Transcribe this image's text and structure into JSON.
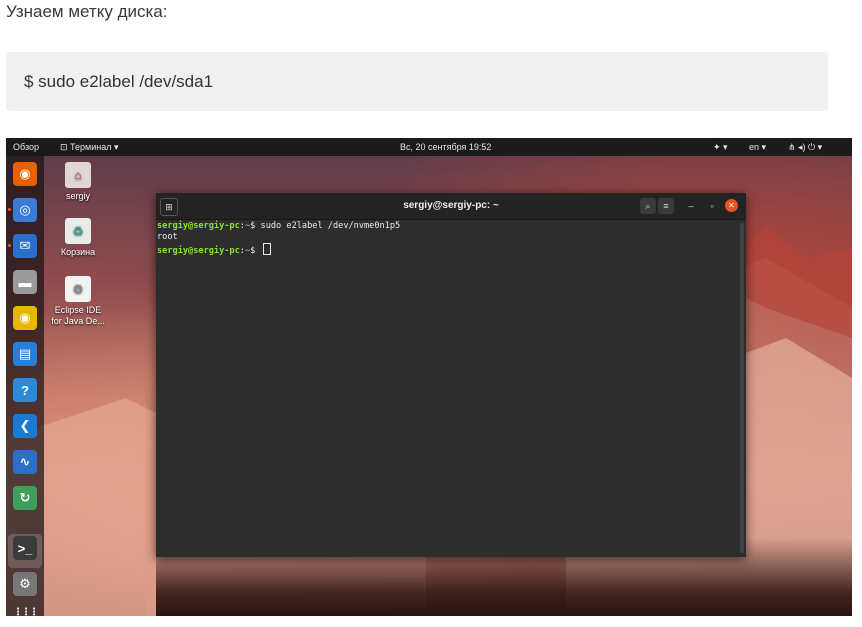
{
  "article": {
    "heading": "Узнаем метку диска:",
    "code": "$  sudo e2label /dev/sda1"
  },
  "topbar": {
    "activities": "Обзор",
    "app_menu": "Терминал",
    "app_menu_arrow": "▾",
    "clock": "Вс, 20 сентября  19:52",
    "accessibility": "✦ ▾",
    "lang": "en ▾",
    "system": "⋔ ◂) ⏻ ▾"
  },
  "desktop": {
    "icons": [
      {
        "label": "sergiy",
        "glyph": "⌂"
      },
      {
        "label": "Корзина",
        "glyph": "♻"
      },
      {
        "label": "Eclipse IDE\nfor Java De...",
        "glyph": "⚙"
      }
    ]
  },
  "dock": {
    "apps": [
      {
        "name": "firefox-icon",
        "glyph": "◉",
        "color": "#e66000"
      },
      {
        "name": "chromium-icon",
        "glyph": "◎",
        "color": "#3b7bd5"
      },
      {
        "name": "thunderbird-icon",
        "glyph": "✉",
        "color": "#2a6fc9"
      },
      {
        "name": "files-icon",
        "glyph": "▬",
        "color": "#9a9a9a"
      },
      {
        "name": "rhythmbox-icon",
        "glyph": "◉",
        "color": "#e7b800"
      },
      {
        "name": "writer-icon",
        "glyph": "▤",
        "color": "#2a7fd4"
      },
      {
        "name": "help-icon",
        "glyph": "?",
        "color": "#2d8ad8"
      },
      {
        "name": "vscode-icon",
        "glyph": "❮",
        "color": "#1c7ad1"
      },
      {
        "name": "system-monitor-icon",
        "glyph": "∿",
        "color": "#2a6fc9"
      },
      {
        "name": "software-updater-icon",
        "glyph": "↻",
        "color": "#3f9f5a"
      },
      {
        "name": "terminal-icon",
        "glyph": ">_",
        "color": "#3a3a3a"
      },
      {
        "name": "settings-icon",
        "glyph": "⚙",
        "color": "#777777"
      },
      {
        "name": "show-apps-icon",
        "glyph": "⋮⋮⋮",
        "color": "transparent"
      }
    ]
  },
  "terminal": {
    "title": "sergiy@sergiy-pc: ~",
    "lines": [
      {
        "prompt": "sergiy@sergiy-pc",
        "sep": ":",
        "path": "~",
        "dollar": "$ ",
        "cmd": "sudo e2label /dev/nvme0n1p5"
      },
      {
        "output": "root"
      },
      {
        "prompt": "sergiy@sergiy-pc",
        "sep": ":",
        "path": "~",
        "dollar": "$ ",
        "cmd": ""
      }
    ]
  }
}
